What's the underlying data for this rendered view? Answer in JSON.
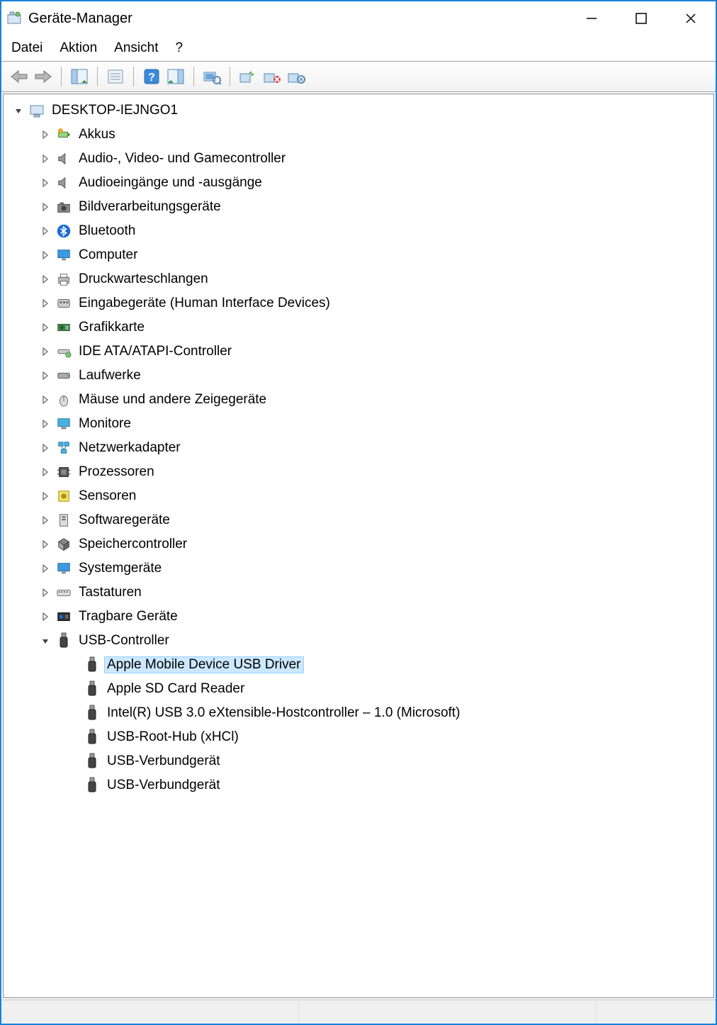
{
  "window": {
    "title": "Geräte-Manager"
  },
  "menu": {
    "datei": "Datei",
    "aktion": "Aktion",
    "ansicht": "Ansicht",
    "help": "?"
  },
  "tree": {
    "root": "DESKTOP-IEJNGO1",
    "categories": [
      {
        "icon": "battery",
        "label": "Akkus"
      },
      {
        "icon": "speaker",
        "label": "Audio-, Video- und Gamecontroller"
      },
      {
        "icon": "speaker",
        "label": "Audioeingänge und -ausgänge"
      },
      {
        "icon": "camera",
        "label": "Bildverarbeitungsgeräte"
      },
      {
        "icon": "bluetooth",
        "label": "Bluetooth"
      },
      {
        "icon": "monitor",
        "label": "Computer"
      },
      {
        "icon": "printer",
        "label": "Druckwarteschlangen"
      },
      {
        "icon": "hid",
        "label": "Eingabegeräte (Human Interface Devices)"
      },
      {
        "icon": "gpu",
        "label": "Grafikkarte"
      },
      {
        "icon": "ide",
        "label": "IDE ATA/ATAPI-Controller"
      },
      {
        "icon": "disk",
        "label": "Laufwerke"
      },
      {
        "icon": "mouse",
        "label": "Mäuse und andere Zeigegeräte"
      },
      {
        "icon": "display",
        "label": "Monitore"
      },
      {
        "icon": "network",
        "label": "Netzwerkadapter"
      },
      {
        "icon": "cpu",
        "label": "Prozessoren"
      },
      {
        "icon": "sensor",
        "label": "Sensoren"
      },
      {
        "icon": "software",
        "label": "Softwaregeräte"
      },
      {
        "icon": "storage",
        "label": "Speichercontroller"
      },
      {
        "icon": "monitor",
        "label": "Systemgeräte"
      },
      {
        "icon": "keyboard",
        "label": "Tastaturen"
      },
      {
        "icon": "portable",
        "label": "Tragbare Geräte"
      }
    ],
    "usb": {
      "label": "USB-Controller",
      "children": [
        {
          "label": "Apple Mobile Device USB Driver",
          "selected": true
        },
        {
          "label": "Apple SD Card Reader"
        },
        {
          "label": "Intel(R) USB 3.0 eXtensible-Hostcontroller – 1.0 (Microsoft)"
        },
        {
          "label": "USB-Root-Hub (xHCl)"
        },
        {
          "label": "USB-Verbundgerät"
        },
        {
          "label": "USB-Verbundgerät"
        }
      ]
    }
  }
}
